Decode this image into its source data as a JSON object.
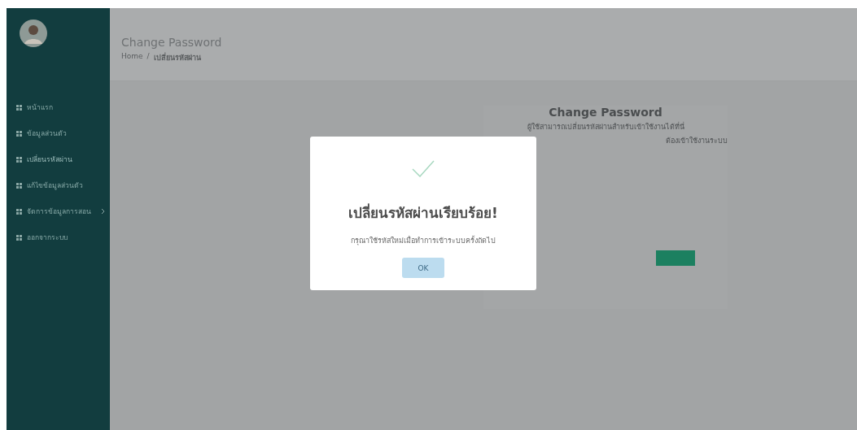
{
  "sidebar": {
    "avatar": {
      "kind": "avatar"
    },
    "items": [
      {
        "label": "หน้าแรก",
        "selected": false,
        "has_submenu": false
      },
      {
        "label": "ข้อมูลส่วนตัว",
        "selected": false,
        "has_submenu": false
      },
      {
        "label": "เปลี่ยนรหัสผ่าน",
        "selected": true,
        "has_submenu": false
      },
      {
        "label": "แก้ไขข้อมูลส่วนตัว",
        "selected": false,
        "has_submenu": false
      },
      {
        "label": "จัดการข้อมูลการสอน",
        "selected": false,
        "has_submenu": true
      },
      {
        "label": "ออกจากระบบ",
        "selected": false,
        "has_submenu": false
      }
    ]
  },
  "header": {
    "title": "Change Password",
    "breadcrumb": [
      "Home",
      "เปลี่ยนรหัสผ่าน"
    ],
    "separator": "/"
  },
  "form": {
    "title": "Change Password",
    "lines": [
      "ผู้ใช้สามารถเปลี่ยนรหัสผ่านสำหรับเข้าใช้งานได้ที่นี่",
      "ต้องเข้าใช้งานระบบ"
    ]
  },
  "dialog": {
    "title": "เปลี่ยนรหัสผ่านเรียบร้อย!",
    "message": "กรุณาใช้รหัสใหม่เมื่อทำการเข้าระบบครั้งถัดไป",
    "button": "OK"
  }
}
